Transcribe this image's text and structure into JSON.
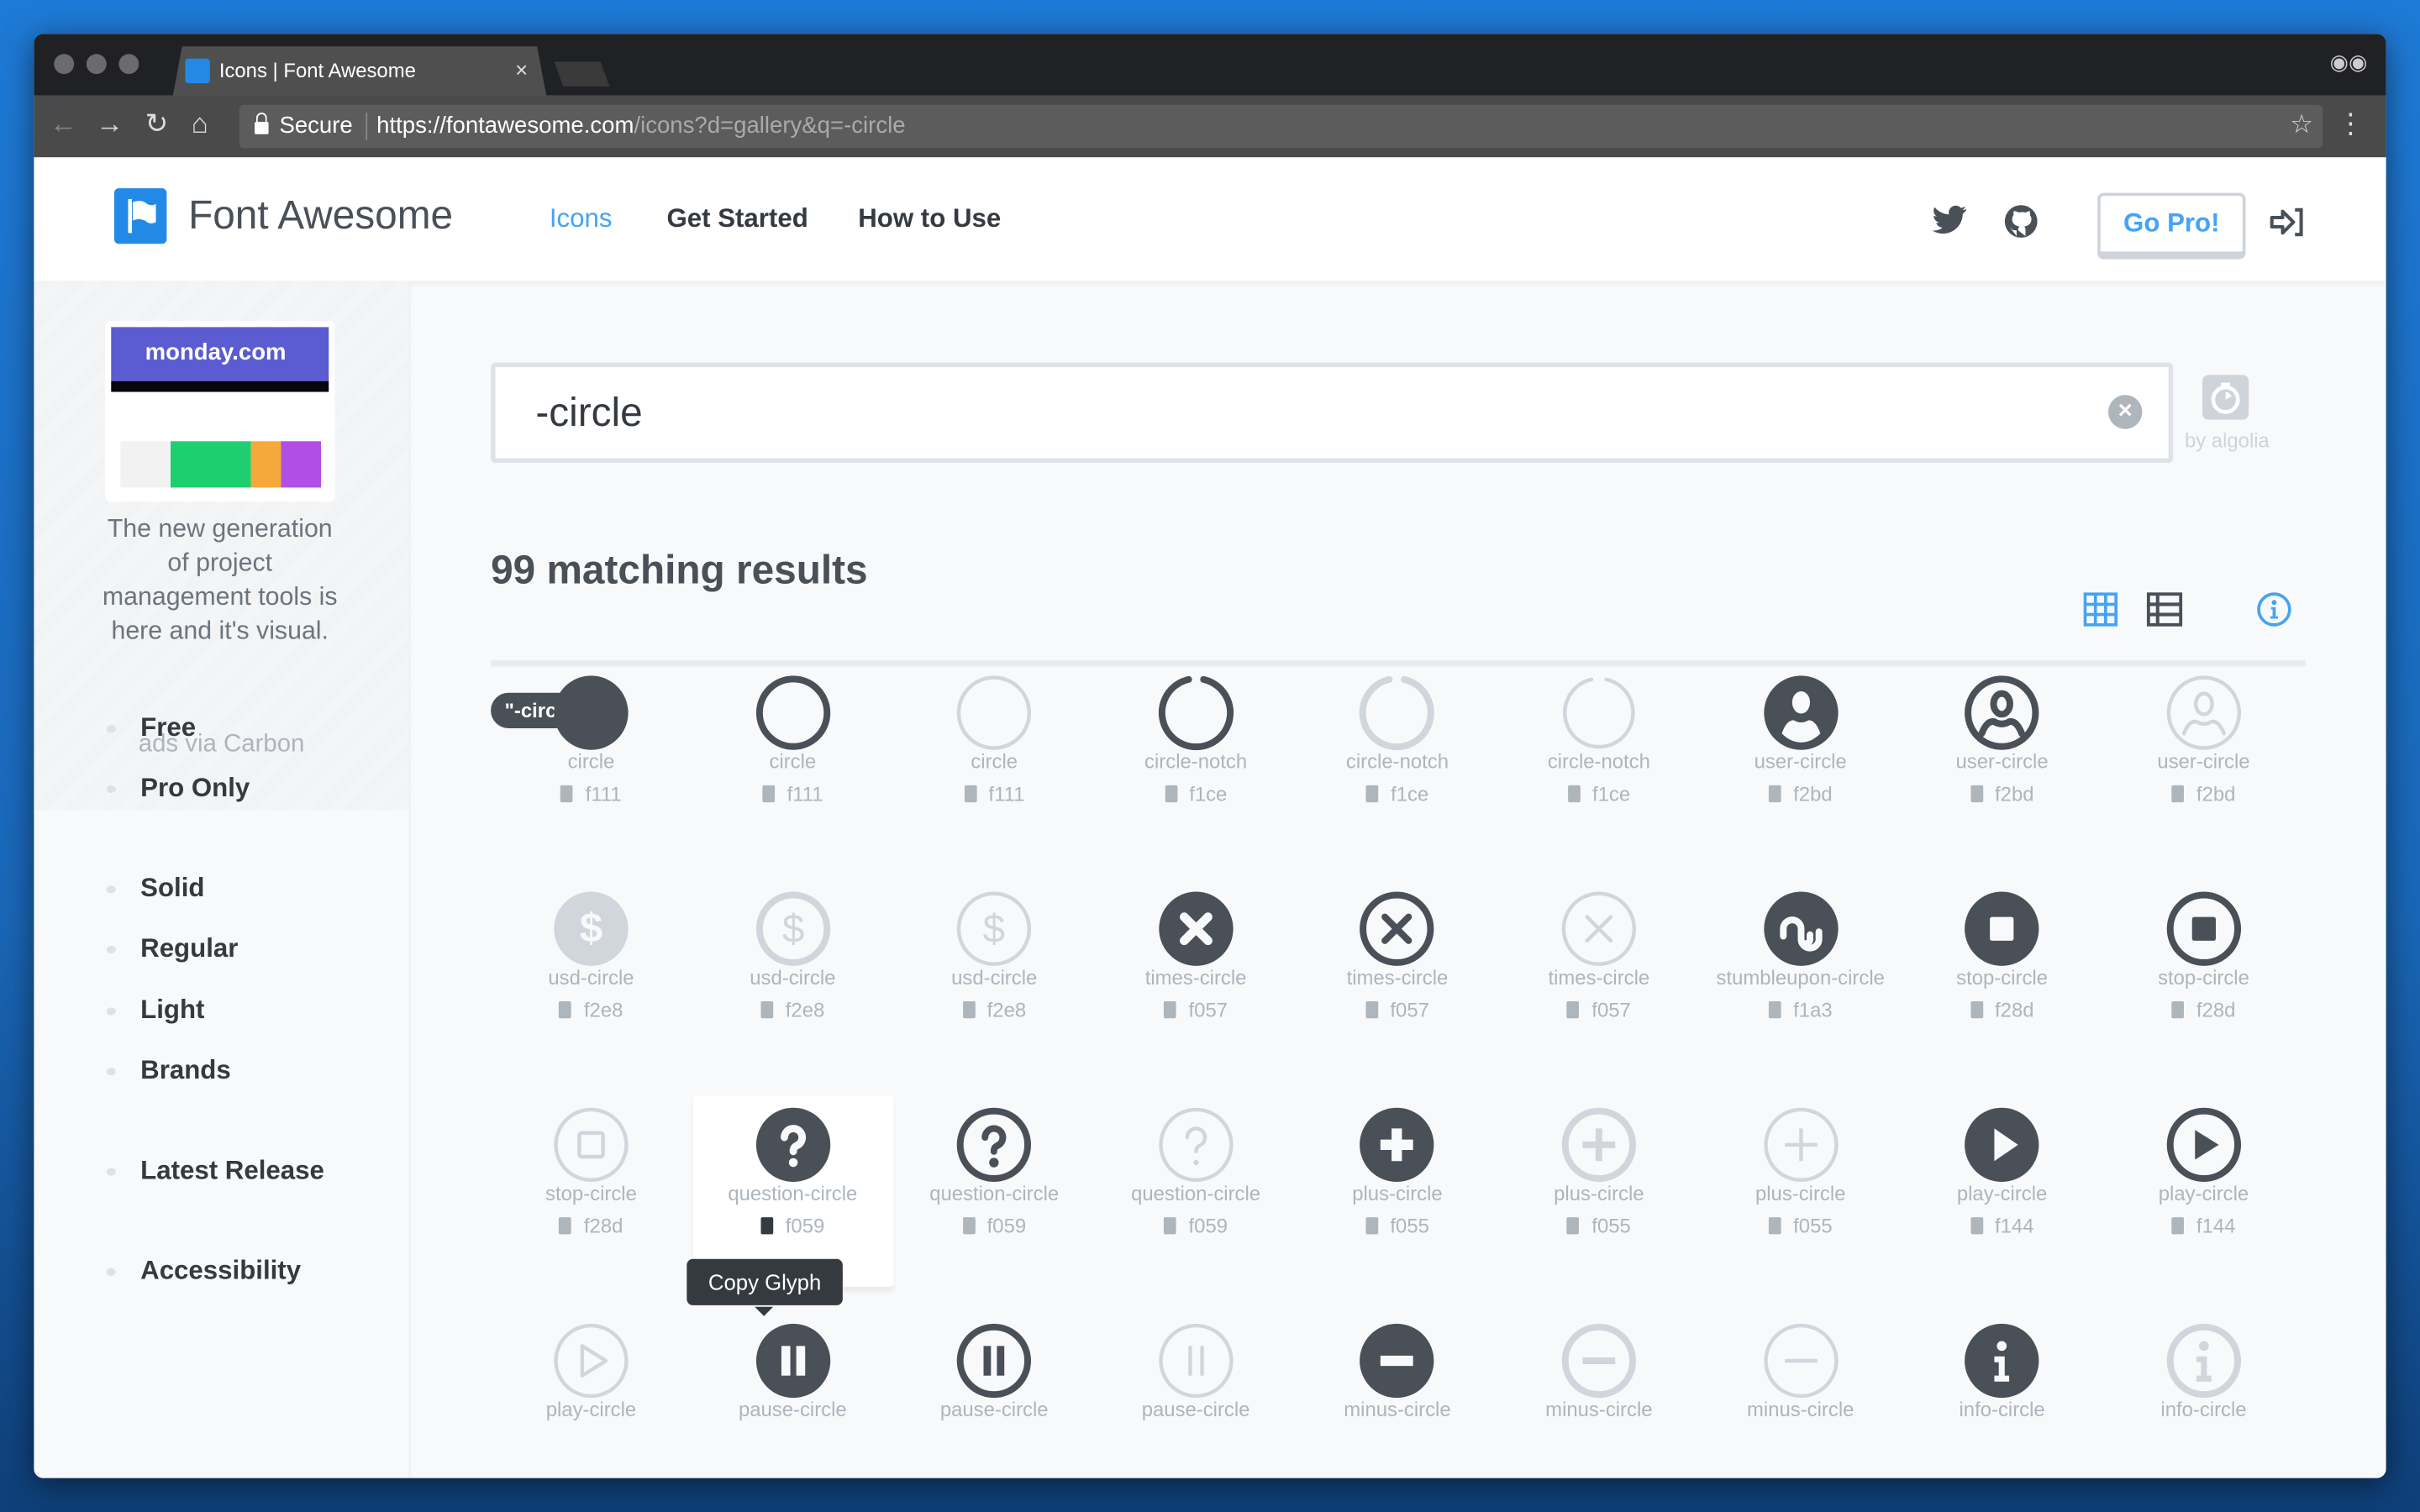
{
  "browser": {
    "tab_title": "Icons | Font Awesome",
    "tab_close": "×",
    "secure_label": "Secure",
    "url_host": "https://fontawesome.com",
    "url_path": "/icons?d=gallery&q=-circle"
  },
  "header": {
    "brand": "Font Awesome",
    "nav": [
      {
        "label": "Icons",
        "active": true
      },
      {
        "label": "Get Started"
      },
      {
        "label": "How to Use"
      }
    ],
    "go_pro": "Go Pro!"
  },
  "ad": {
    "logo_text": "monday.com",
    "text": "The new generation of project management tools is here and it's visual.",
    "via": "ads via Carbon"
  },
  "sidebar": {
    "items": [
      {
        "label": "Free"
      },
      {
        "label": "Pro Only"
      },
      {
        "label": "Solid"
      },
      {
        "label": "Regular"
      },
      {
        "label": "Light"
      },
      {
        "label": "Brands"
      },
      {
        "label": "Latest Release"
      },
      {
        "label": "Accessibility"
      }
    ]
  },
  "search": {
    "value": "-circle",
    "powered_by": "by algolia"
  },
  "results": {
    "count_label": "99 matching results",
    "filter_chip": "\"-circle\"",
    "tooltip": "Copy Glyph",
    "icons": [
      {
        "name": "circle",
        "code": "f111",
        "glyph": "circle",
        "style": "solid",
        "tone": "dark"
      },
      {
        "name": "circle",
        "code": "f111",
        "glyph": "circle",
        "style": "regular",
        "tone": "dark"
      },
      {
        "name": "circle",
        "code": "f111",
        "glyph": "circle",
        "style": "light",
        "tone": "light"
      },
      {
        "name": "circle-notch",
        "code": "f1ce",
        "glyph": "notch",
        "style": "regular",
        "tone": "dark"
      },
      {
        "name": "circle-notch",
        "code": "f1ce",
        "glyph": "notch",
        "style": "regular",
        "tone": "light"
      },
      {
        "name": "circle-notch",
        "code": "f1ce",
        "glyph": "notch",
        "style": "light",
        "tone": "light"
      },
      {
        "name": "user-circle",
        "code": "f2bd",
        "glyph": "user",
        "style": "solid",
        "tone": "dark"
      },
      {
        "name": "user-circle",
        "code": "f2bd",
        "glyph": "user",
        "style": "regular",
        "tone": "dark"
      },
      {
        "name": "user-circle",
        "code": "f2bd",
        "glyph": "user",
        "style": "light",
        "tone": "light"
      },
      {
        "name": "usd-circle",
        "code": "f2e8",
        "glyph": "usd",
        "style": "solid",
        "tone": "light"
      },
      {
        "name": "usd-circle",
        "code": "f2e8",
        "glyph": "usd",
        "style": "regular",
        "tone": "light"
      },
      {
        "name": "usd-circle",
        "code": "f2e8",
        "glyph": "usd",
        "style": "light",
        "tone": "light"
      },
      {
        "name": "times-circle",
        "code": "f057",
        "glyph": "times",
        "style": "solid",
        "tone": "dark"
      },
      {
        "name": "times-circle",
        "code": "f057",
        "glyph": "times",
        "style": "regular",
        "tone": "dark"
      },
      {
        "name": "times-circle",
        "code": "f057",
        "glyph": "times",
        "style": "light",
        "tone": "light"
      },
      {
        "name": "stumbleupon-circle",
        "code": "f1a3",
        "glyph": "stumble",
        "style": "solid",
        "tone": "dark"
      },
      {
        "name": "stop-circle",
        "code": "f28d",
        "glyph": "stop",
        "style": "solid",
        "tone": "dark"
      },
      {
        "name": "stop-circle",
        "code": "f28d",
        "glyph": "stop",
        "style": "regular",
        "tone": "dark"
      },
      {
        "name": "stop-circle",
        "code": "f28d",
        "glyph": "stop",
        "style": "light",
        "tone": "light"
      },
      {
        "name": "question-circle",
        "code": "f059",
        "glyph": "question",
        "style": "solid",
        "tone": "dark",
        "hovered": true
      },
      {
        "name": "question-circle",
        "code": "f059",
        "glyph": "question",
        "style": "regular",
        "tone": "dark"
      },
      {
        "name": "question-circle",
        "code": "f059",
        "glyph": "question",
        "style": "light",
        "tone": "light"
      },
      {
        "name": "plus-circle",
        "code": "f055",
        "glyph": "plus",
        "style": "solid",
        "tone": "dark"
      },
      {
        "name": "plus-circle",
        "code": "f055",
        "glyph": "plus",
        "style": "regular",
        "tone": "light"
      },
      {
        "name": "plus-circle",
        "code": "f055",
        "glyph": "plus",
        "style": "light",
        "tone": "light"
      },
      {
        "name": "play-circle",
        "code": "f144",
        "glyph": "play",
        "style": "solid",
        "tone": "dark"
      },
      {
        "name": "play-circle",
        "code": "f144",
        "glyph": "play",
        "style": "regular",
        "tone": "dark"
      },
      {
        "name": "play-circle",
        "code": "",
        "glyph": "play",
        "style": "light",
        "tone": "light"
      },
      {
        "name": "pause-circle",
        "code": "",
        "glyph": "pause",
        "style": "solid",
        "tone": "dark"
      },
      {
        "name": "pause-circle",
        "code": "",
        "glyph": "pause",
        "style": "regular",
        "tone": "dark"
      },
      {
        "name": "pause-circle",
        "code": "",
        "glyph": "pause",
        "style": "light",
        "tone": "light"
      },
      {
        "name": "minus-circle",
        "code": "",
        "glyph": "minus",
        "style": "solid",
        "tone": "dark"
      },
      {
        "name": "minus-circle",
        "code": "",
        "glyph": "minus",
        "style": "regular",
        "tone": "light"
      },
      {
        "name": "minus-circle",
        "code": "",
        "glyph": "minus",
        "style": "light",
        "tone": "light"
      },
      {
        "name": "info-circle",
        "code": "",
        "glyph": "info",
        "style": "solid",
        "tone": "dark"
      },
      {
        "name": "info-circle",
        "code": "",
        "glyph": "info",
        "style": "regular",
        "tone": "light"
      }
    ]
  },
  "colors": {
    "accent": "#45a3f5",
    "brand": "#228ae6",
    "icon_dark": "#495057",
    "icon_light": "#d1d6dc",
    "label": "#adb5bd"
  }
}
